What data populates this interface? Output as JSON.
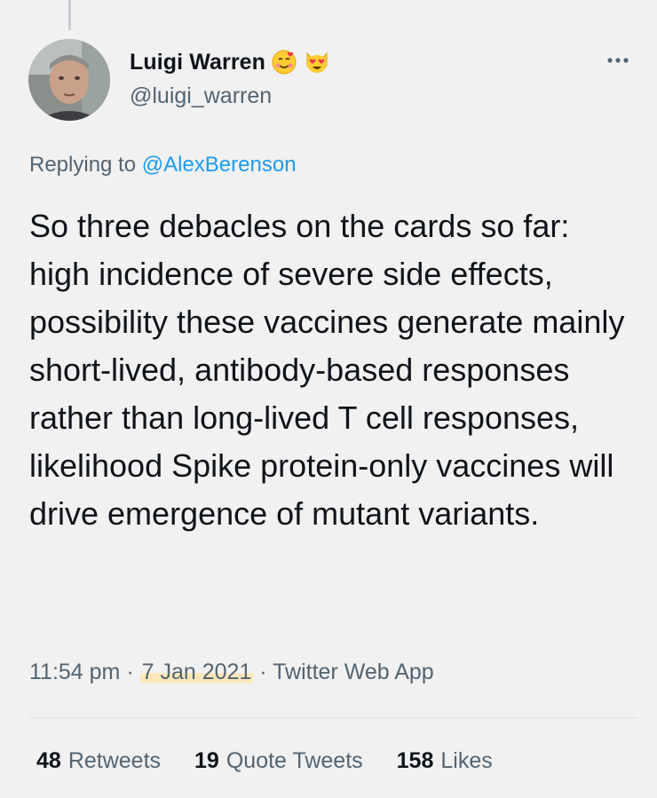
{
  "author": {
    "display_name": "Luigi Warren",
    "handle": "@luigi_warren",
    "emojis": [
      "smiling-face-with-hearts-icon",
      "heart-eyes-cat-icon"
    ]
  },
  "reply": {
    "prefix": "Replying to",
    "mention": "@AlexBerenson"
  },
  "tweet": {
    "text": "So three debacles on the cards so far: high incidence of severe side effects, possibility these vaccines generate mainly short-lived, antibody-based responses rather than long-lived T cell responses, likelihood Spike protein-only vaccines will drive emergence of mutant variants."
  },
  "meta": {
    "time": "11:54 pm",
    "sep1": "·",
    "date": "7 Jan 2021",
    "sep2": "·",
    "source": "Twitter Web App"
  },
  "stats": {
    "retweets": {
      "count": "48",
      "label": "Retweets"
    },
    "quotes": {
      "count": "19",
      "label": "Quote Tweets"
    },
    "likes": {
      "count": "158",
      "label": "Likes"
    }
  },
  "colors": {
    "background": "#f1f1f2",
    "text": "#0f1419",
    "secondary": "#536471",
    "link": "#1d9bf0",
    "highlight": "#fbe6b8"
  }
}
